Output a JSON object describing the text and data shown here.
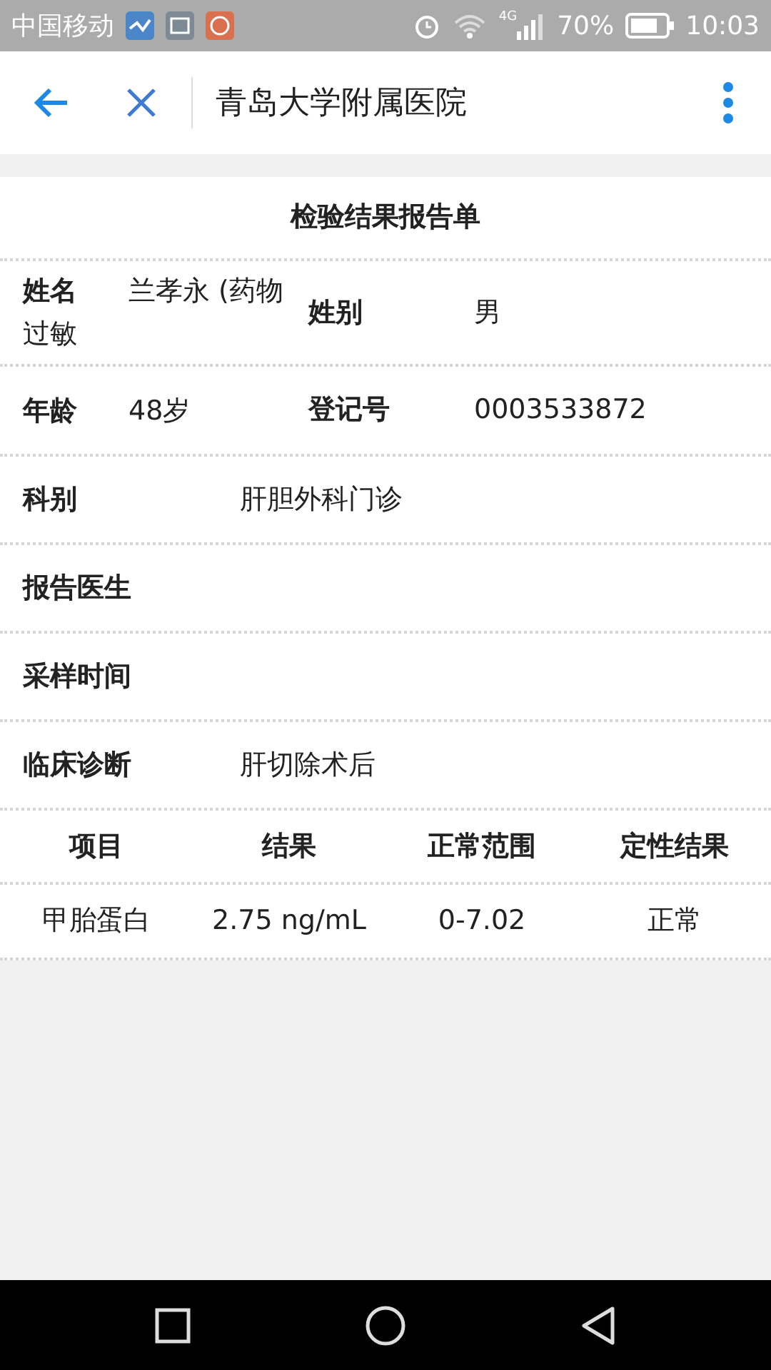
{
  "status_bar": {
    "carrier": "中国移动",
    "network": "4G",
    "battery": "70%",
    "time": "10:03"
  },
  "header": {
    "title": "青岛大学附属医院"
  },
  "report": {
    "title": "检验结果报告单",
    "pair_rows": [
      [
        {
          "label": "姓名",
          "value": "兰孝永 (药物过敏"
        },
        {
          "label": "姓别",
          "value": "男"
        }
      ],
      [
        {
          "label": "年龄",
          "value": "48岁"
        },
        {
          "label": "登记号",
          "value": "0003533872"
        }
      ]
    ],
    "rows": [
      {
        "label": "科别",
        "value": "肝胆外科门诊"
      },
      {
        "label": "报告医生"
      },
      {
        "label": "采样时间"
      },
      {
        "label": "临床诊断",
        "value": "肝切除术后"
      }
    ],
    "table": {
      "columns": [
        "项目",
        "结果",
        "正常范围",
        "定性结果"
      ],
      "rows": [
        [
          "甲胎蛋白",
          "2.75 ng/mL",
          "0-7.02",
          "正常"
        ]
      ]
    }
  }
}
